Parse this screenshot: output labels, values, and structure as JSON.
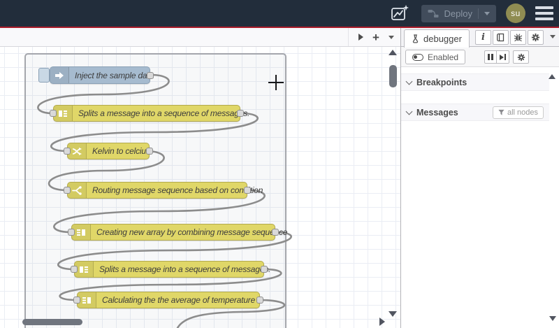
{
  "header": {
    "deploy": {
      "label": "Deploy"
    },
    "avatar": {
      "initials": "su"
    },
    "icons": [
      "export-image-icon",
      "deploy-icon",
      "deploy-options-chevron-icon",
      "main-menu-icon"
    ]
  },
  "flow_tabbar": {
    "buttons": [
      "next-flow-icon",
      "add-flow-plus-icon",
      "flow-list-chevron-icon"
    ]
  },
  "canvas": {
    "nodes": [
      {
        "type": "inject",
        "label": "Inject the sample data",
        "color": "#a6bbcf",
        "icon": "inject-arrow-icon"
      },
      {
        "type": "split",
        "label": "Splits a message into a sequence of messages.",
        "color": "#e0d768",
        "icon": "split-icon"
      },
      {
        "type": "change",
        "label": "Kelvin to celcius",
        "color": "#e0d768",
        "icon": "shuffle-icon"
      },
      {
        "type": "switch",
        "label": "Routing message sequence based on condition",
        "color": "#e0d768",
        "icon": "fork-icon"
      },
      {
        "type": "join",
        "label": "Creating new array by combining message sequence",
        "color": "#e0d768",
        "icon": "join-icon"
      },
      {
        "type": "split",
        "label": "Splits a message into a sequence of messages.",
        "color": "#e0d768",
        "icon": "split-icon"
      },
      {
        "type": "join",
        "label": "Calculating the the average of temperature",
        "color": "#e0d768",
        "icon": "join-icon"
      }
    ],
    "group_selected": true
  },
  "sidebar": {
    "tab": {
      "label": "debugger",
      "icon": "flask-icon"
    },
    "tab_buttons": [
      "info-icon",
      "library-icon",
      "bug-icon",
      "gear-icon",
      "chevron-down-icon"
    ],
    "enabled_toggle": {
      "label": "Enabled"
    },
    "debug_buttons": [
      "pause-icon",
      "step-icon",
      "gear-icon"
    ],
    "sections": [
      {
        "title": "Breakpoints"
      },
      {
        "title": "Messages",
        "filter": {
          "label": "all nodes",
          "icon": "funnel-icon"
        }
      }
    ]
  },
  "colors": {
    "header_bg": "#222d3b",
    "alert_red": "#ad1d2b",
    "inject_node": "#a6bbcf",
    "function_yellow": "#e0d768",
    "wire": "#8c8c8c",
    "avatar_bg": "#8f8c52"
  }
}
